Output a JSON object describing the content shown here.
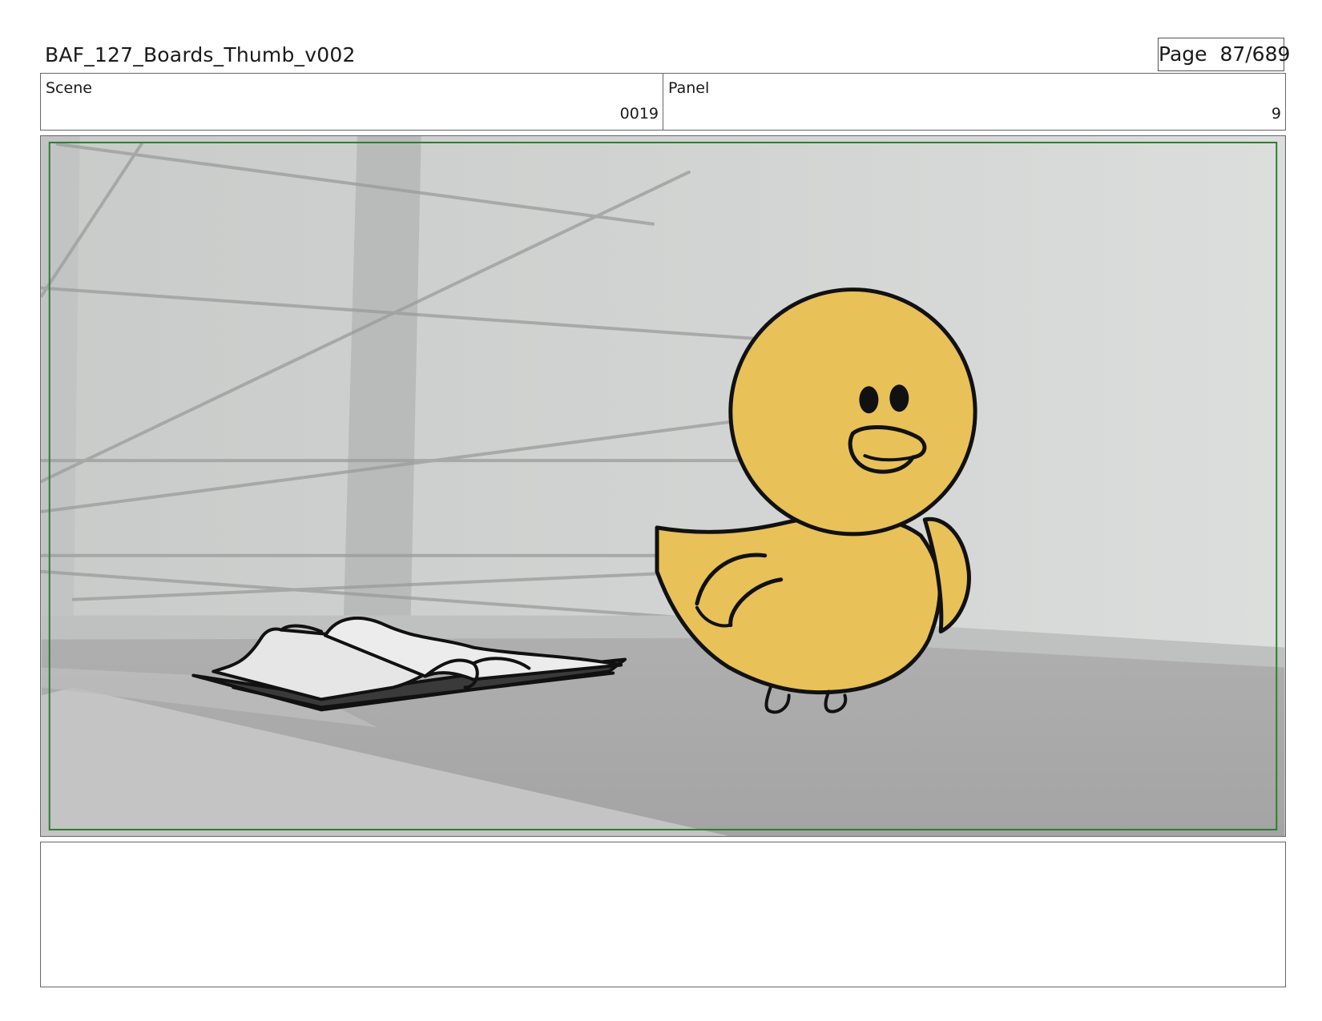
{
  "header": {
    "title": "BAF_127_Boards_Thumb_v002",
    "page_label": "Page",
    "page_number": "87/689"
  },
  "info": {
    "scene_label": "Scene",
    "scene_value": "0019",
    "panel_label": "Panel",
    "panel_value": "9"
  },
  "notes": {
    "text": ""
  },
  "colors": {
    "duck_body": "#e8c158",
    "safe_frame": "#2e7d32",
    "wall": "#cfd1d0",
    "floor": "#a9a9a9"
  }
}
